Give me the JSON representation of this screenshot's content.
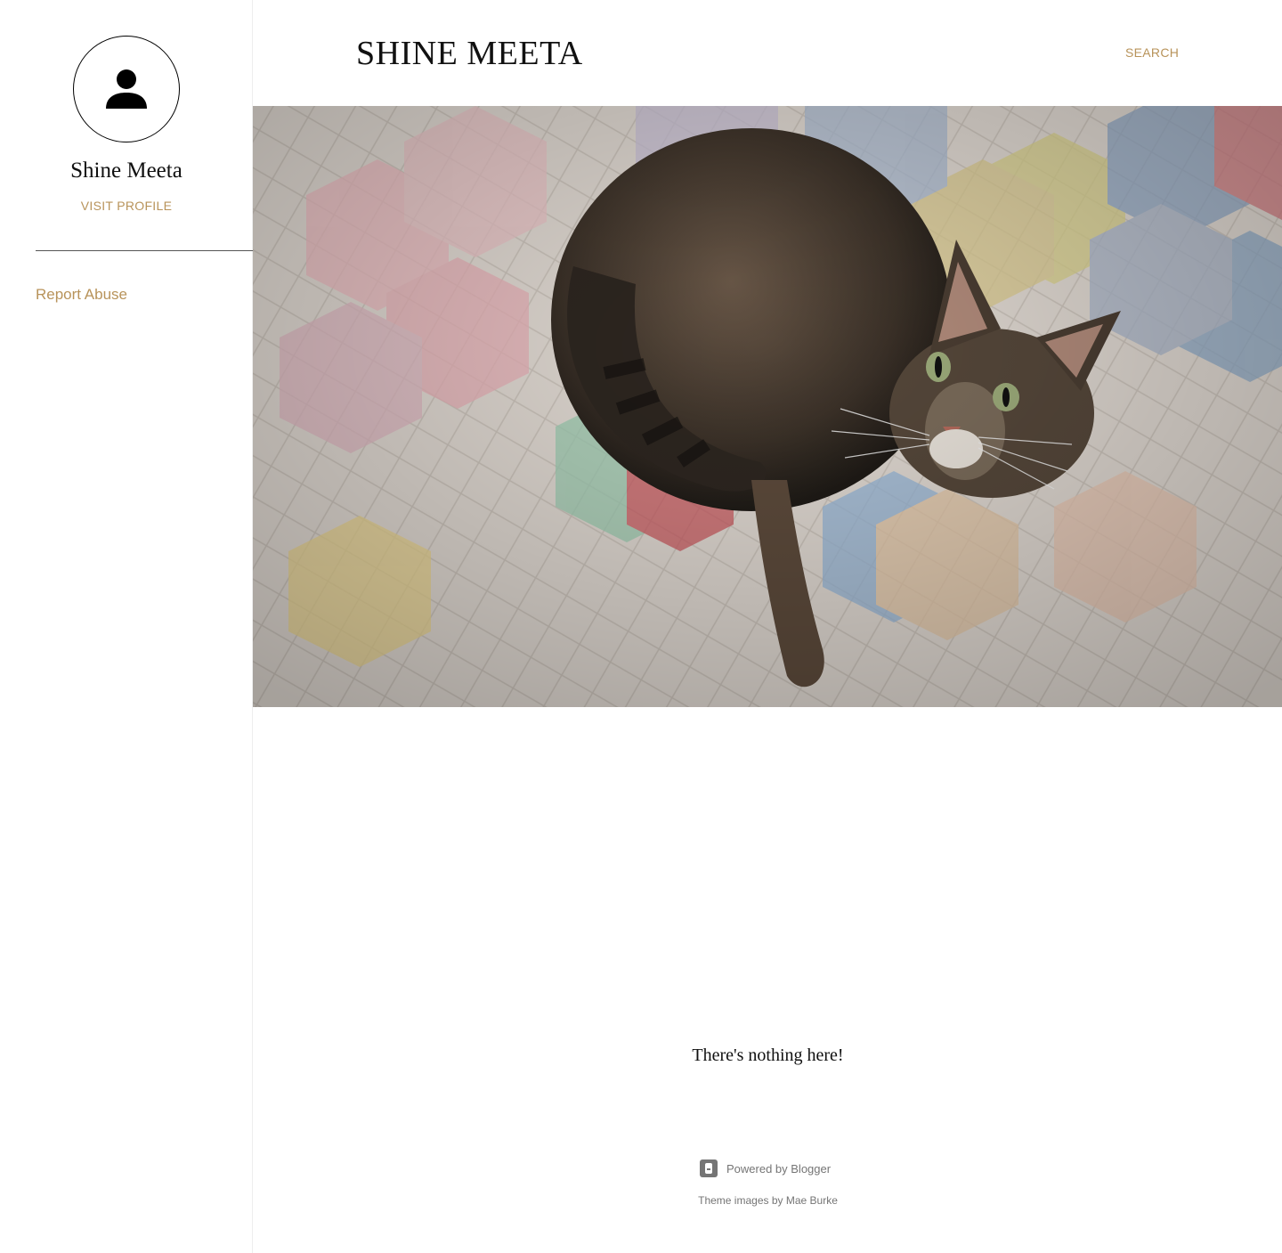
{
  "sidebar": {
    "profile_name": "Shine Meeta",
    "visit_profile_label": "VISIT PROFILE",
    "report_abuse_label": "Report Abuse"
  },
  "header": {
    "site_title": "SHINE MEETA",
    "search_label": "SEARCH"
  },
  "main": {
    "empty_message": "There's nothing here!"
  },
  "footer": {
    "powered_by_label": "Powered by Blogger",
    "theme_credit_prefix": "Theme images by",
    "theme_credit_author": "Mae Burke"
  },
  "colors": {
    "accent": "#b8935a",
    "text": "#111111",
    "muted": "#757575"
  },
  "icons": {
    "avatar": "person-icon",
    "footer": "blogger-icon"
  }
}
